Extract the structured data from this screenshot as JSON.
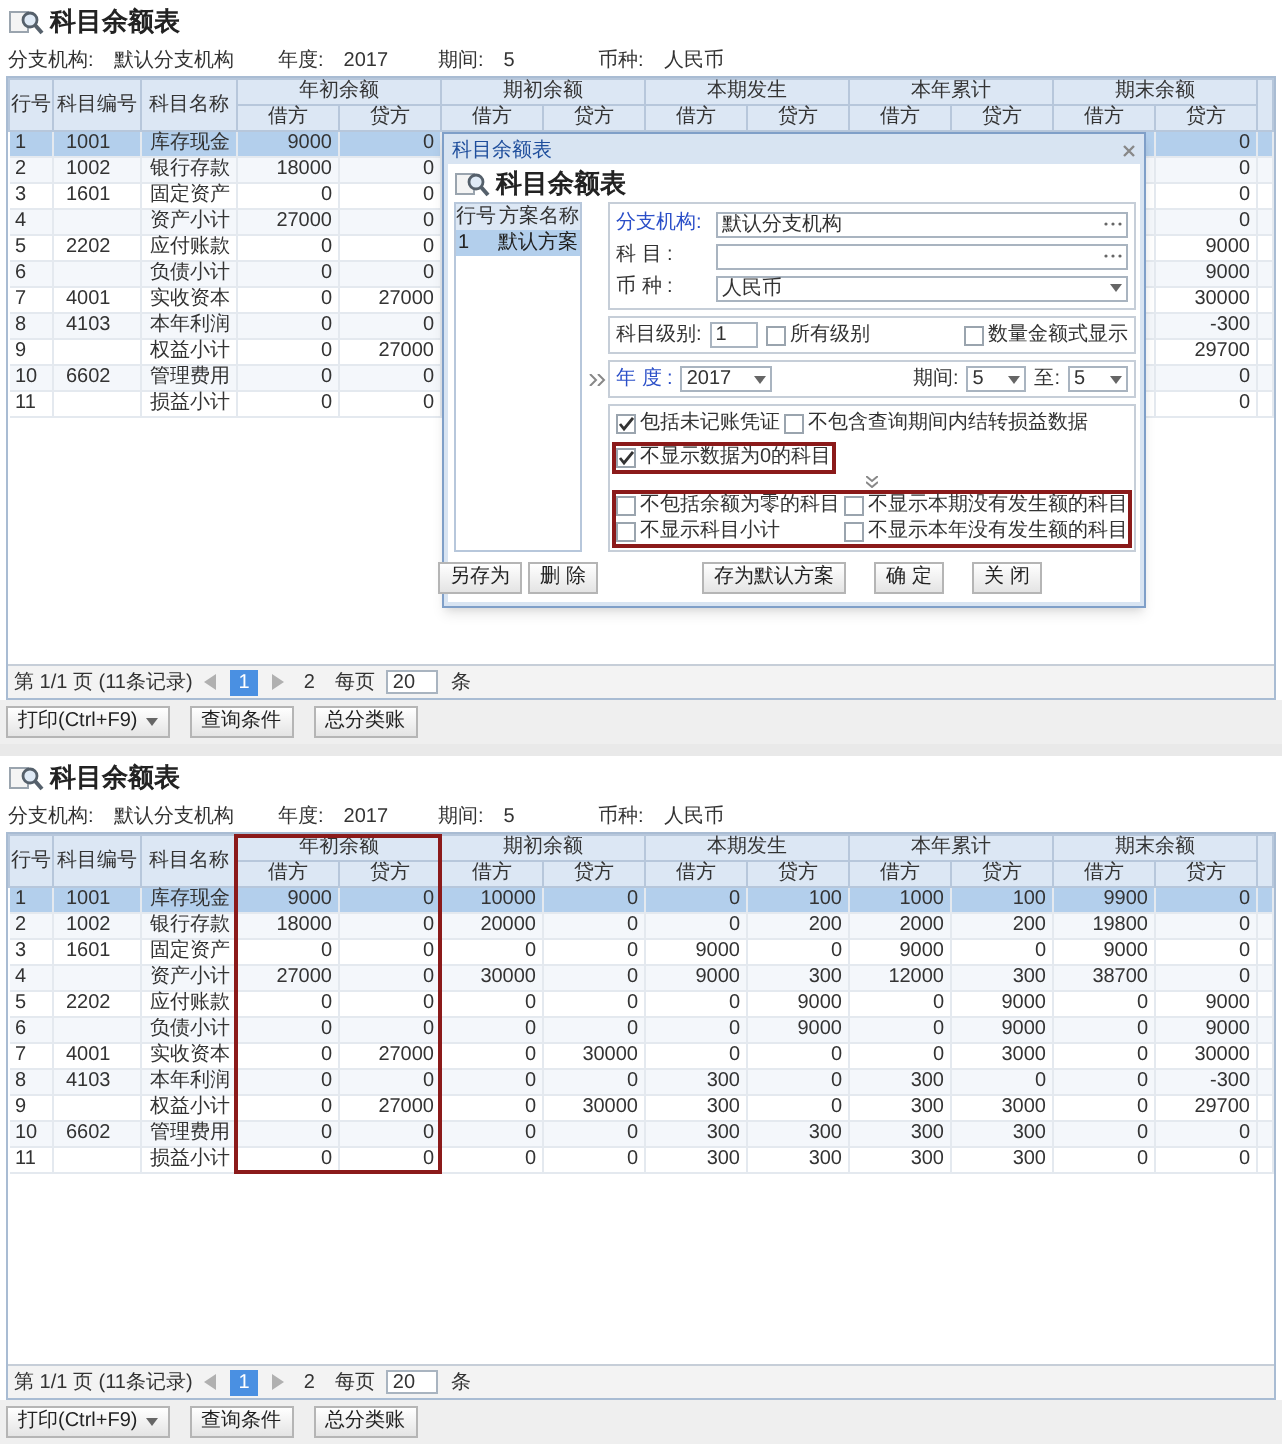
{
  "main_top": {
    "title": "科目余额表",
    "filters": [
      {
        "label": "分支机构:",
        "value": "默认分支机构"
      },
      {
        "label": "年度:",
        "value": "2017"
      },
      {
        "label": "期间:",
        "value": "5"
      },
      {
        "label": "币种:",
        "value": "人民币"
      }
    ],
    "table": {
      "fixed_columns": [
        "行号",
        "科目编号",
        "科目名称"
      ],
      "column_groups": [
        {
          "label": "年初余额",
          "highlighted": false,
          "subcolumns": [
            "借方",
            "贷方"
          ]
        },
        {
          "label": "期初余额",
          "highlighted": false,
          "subcolumns": [
            "借方",
            "贷方"
          ]
        },
        {
          "label": "本期发生",
          "highlighted": false,
          "subcolumns": [
            "借方",
            "贷方"
          ]
        },
        {
          "label": "本年累计",
          "highlighted": false,
          "subcolumns": [
            "借方",
            "贷方"
          ]
        },
        {
          "label": "期末余额",
          "highlighted": false,
          "subcolumns": [
            "借方",
            "贷方"
          ]
        }
      ],
      "rows": [
        {
          "no": "1",
          "code": "1001",
          "name": "库存现金",
          "values": [
            "9000",
            "0",
            "0"
          ],
          "selected": true
        },
        {
          "no": "2",
          "code": "1002",
          "name": "银行存款",
          "values": [
            "18000",
            "0",
            "0"
          ],
          "selected": false
        },
        {
          "no": "3",
          "code": "1601",
          "name": "固定资产",
          "values": [
            "0",
            "0",
            "0"
          ],
          "selected": false
        },
        {
          "no": "4",
          "name": "资产小计",
          "values": [
            "27000",
            "0",
            "0"
          ],
          "selected": false
        },
        {
          "no": "5",
          "code": "2202",
          "name": "应付账款",
          "values": [
            "0",
            "0",
            "9000"
          ],
          "selected": false
        },
        {
          "no": "6",
          "name": "负债小计",
          "values": [
            "0",
            "0",
            "9000"
          ],
          "selected": false
        },
        {
          "no": "7",
          "code": "4001",
          "name": "实收资本",
          "values": [
            "0",
            "27000",
            "30000"
          ],
          "selected": false
        },
        {
          "no": "8",
          "code": "4103",
          "name": "本年利润",
          "values": [
            "0",
            "0",
            "-300"
          ],
          "selected": false
        },
        {
          "no": "9",
          "name": "权益小计",
          "values": [
            "0",
            "27000",
            "29700"
          ],
          "selected": false
        },
        {
          "no": "10",
          "code": "6602",
          "name": "管理费用",
          "values": [
            "0",
            "0",
            "0"
          ],
          "selected": false
        },
        {
          "no": "11",
          "name": "损益小计",
          "values": [
            "0",
            "0",
            "0"
          ],
          "selected": false
        }
      ]
    },
    "pagination": {
      "page_text": "第 1/1 页 (11条记录)",
      "current_page": "1",
      "next_text": "2",
      "per_page_label": "每页",
      "per_page": "20",
      "unit": "条"
    },
    "buttons": [
      {
        "label": "打印(Ctrl+F9)",
        "dropdown": true
      },
      {
        "label": "查询条件",
        "dropdown": false
      },
      {
        "label": "总分类账",
        "dropdown": false
      }
    ]
  },
  "dialog": {
    "title": "科目余额表",
    "heading": "科目余额表",
    "scheme_list": {
      "columns": [
        "行号",
        "方案名称"
      ],
      "rows": [
        {
          "no": "1",
          "name": "默认方案",
          "selected": true
        }
      ]
    },
    "scheme_buttons": [
      "另存为",
      "删 除"
    ],
    "fields": [
      {
        "label": "分支机构:",
        "value": "默认分支机构",
        "kind": "browse",
        "required": true
      },
      {
        "label": "科 目 :",
        "kind": "browse",
        "required": false
      },
      {
        "label": "币 种 :",
        "value": "人民币",
        "kind": "select",
        "required": false
      }
    ],
    "level": {
      "label": "科目级别:",
      "value": "1",
      "options": [
        {
          "label": "所有级别",
          "checked": false
        },
        {
          "label": "数量金额式显示",
          "checked": false
        }
      ]
    },
    "period": {
      "year_label": "年 度 :",
      "year": "2017",
      "year_required": true,
      "from_label": "期间:",
      "from": "5",
      "to_label": "至:",
      "to": "5"
    },
    "option_groups": [
      {
        "highlighted": false,
        "items": [
          {
            "label": "包括未记账凭证",
            "checked": true
          },
          {
            "label": "不包含查询期间内结转损益数据",
            "checked": false
          }
        ]
      },
      {
        "highlighted": true,
        "items": [
          {
            "label": "不显示数据为0的科目",
            "checked": true
          }
        ]
      },
      {
        "highlighted": true,
        "items": [
          {
            "label": "不包括余额为零的科目",
            "checked": false
          },
          {
            "label": "不显示本期没有发生额的科目",
            "checked": false
          },
          {
            "label": "不显示科目小计",
            "checked": false
          },
          {
            "label": "不显示本年没有发生额的科目",
            "checked": false
          }
        ]
      }
    ],
    "buttons": [
      "存为默认方案",
      "确 定",
      "关 闭"
    ]
  },
  "main_bottom": {
    "title": "科目余额表",
    "filters": [
      {
        "label": "分支机构:",
        "value": "默认分支机构"
      },
      {
        "label": "年度:",
        "value": "2017"
      },
      {
        "label": "期间:",
        "value": "5"
      },
      {
        "label": "币种:",
        "value": "人民币"
      }
    ],
    "table": {
      "fixed_columns": [
        "行号",
        "科目编号",
        "科目名称"
      ],
      "column_groups": [
        {
          "label": "年初余额",
          "highlighted": true,
          "subcolumns": [
            "借方",
            "贷方"
          ]
        },
        {
          "label": "期初余额",
          "highlighted": false,
          "subcolumns": [
            "借方",
            "贷方"
          ]
        },
        {
          "label": "本期发生",
          "highlighted": false,
          "subcolumns": [
            "借方",
            "贷方"
          ]
        },
        {
          "label": "本年累计",
          "highlighted": false,
          "subcolumns": [
            "借方",
            "贷方"
          ]
        },
        {
          "label": "期末余额",
          "highlighted": false,
          "subcolumns": [
            "借方",
            "贷方"
          ]
        }
      ],
      "rows": [
        {
          "no": "1",
          "code": "1001",
          "name": "库存现金",
          "values": [
            "9000",
            "0",
            "10000",
            "0",
            "0",
            "100",
            "1000",
            "100",
            "9900",
            "0"
          ],
          "selected": true
        },
        {
          "no": "2",
          "code": "1002",
          "name": "银行存款",
          "values": [
            "18000",
            "0",
            "20000",
            "0",
            "0",
            "200",
            "2000",
            "200",
            "19800",
            "0"
          ],
          "selected": false
        },
        {
          "no": "3",
          "code": "1601",
          "name": "固定资产",
          "values": [
            "0",
            "0",
            "0",
            "0",
            "9000",
            "0",
            "9000",
            "0",
            "9000",
            "0"
          ],
          "selected": false
        },
        {
          "no": "4",
          "name": "资产小计",
          "values": [
            "27000",
            "0",
            "30000",
            "0",
            "9000",
            "300",
            "12000",
            "300",
            "38700",
            "0"
          ],
          "selected": false
        },
        {
          "no": "5",
          "code": "2202",
          "name": "应付账款",
          "values": [
            "0",
            "0",
            "0",
            "0",
            "0",
            "9000",
            "0",
            "9000",
            "0",
            "9000"
          ],
          "selected": false
        },
        {
          "no": "6",
          "name": "负债小计",
          "values": [
            "0",
            "0",
            "0",
            "0",
            "0",
            "9000",
            "0",
            "9000",
            "0",
            "9000"
          ],
          "selected": false
        },
        {
          "no": "7",
          "code": "4001",
          "name": "实收资本",
          "values": [
            "0",
            "27000",
            "0",
            "30000",
            "0",
            "0",
            "0",
            "3000",
            "0",
            "30000"
          ],
          "selected": false
        },
        {
          "no": "8",
          "code": "4103",
          "name": "本年利润",
          "values": [
            "0",
            "0",
            "0",
            "0",
            "300",
            "0",
            "300",
            "0",
            "0",
            "-300"
          ],
          "selected": false
        },
        {
          "no": "9",
          "name": "权益小计",
          "values": [
            "0",
            "27000",
            "0",
            "30000",
            "300",
            "0",
            "300",
            "3000",
            "0",
            "29700"
          ],
          "selected": false
        },
        {
          "no": "10",
          "code": "6602",
          "name": "管理费用",
          "values": [
            "0",
            "0",
            "0",
            "0",
            "300",
            "300",
            "300",
            "300",
            "0",
            "0"
          ],
          "selected": false
        },
        {
          "no": "11",
          "name": "损益小计",
          "values": [
            "0",
            "0",
            "0",
            "0",
            "300",
            "300",
            "300",
            "300",
            "0",
            "0"
          ],
          "selected": false
        }
      ]
    },
    "pagination": {
      "page_text": "第 1/1 页 (11条记录)",
      "current_page": "1",
      "next_text": "2",
      "per_page_label": "每页",
      "per_page": "20",
      "unit": "条"
    },
    "buttons": [
      {
        "label": "打印(Ctrl+F9)",
        "dropdown": true
      },
      {
        "label": "查询条件",
        "dropdown": false
      },
      {
        "label": "总分类账",
        "dropdown": false
      }
    ]
  }
}
